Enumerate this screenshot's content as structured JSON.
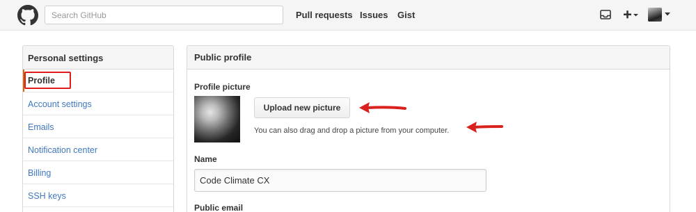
{
  "header": {
    "logo_icon": "github-octocat-icon",
    "search_placeholder": "Search GitHub",
    "nav": {
      "pull_requests": "Pull requests",
      "issues": "Issues",
      "gist": "Gist"
    },
    "icons": [
      "inbox-icon",
      "plus-icon",
      "caret-down-icon",
      "avatar"
    ]
  },
  "sidebar": {
    "title": "Personal settings",
    "items": [
      {
        "label": "Profile",
        "active": true
      },
      {
        "label": "Account settings"
      },
      {
        "label": "Emails"
      },
      {
        "label": "Notification center"
      },
      {
        "label": "Billing"
      },
      {
        "label": "SSH keys"
      }
    ]
  },
  "main": {
    "title": "Public profile",
    "profile_picture_label": "Profile picture",
    "upload_button": "Upload new picture",
    "drag_hint": "You can also drag and drop a picture from your computer.",
    "name_label": "Name",
    "name_value": "Code Climate CX",
    "public_email_label": "Public email"
  },
  "annotations": {
    "highlight_color": "#e01b1b",
    "arrow_color": "#d9211d"
  }
}
